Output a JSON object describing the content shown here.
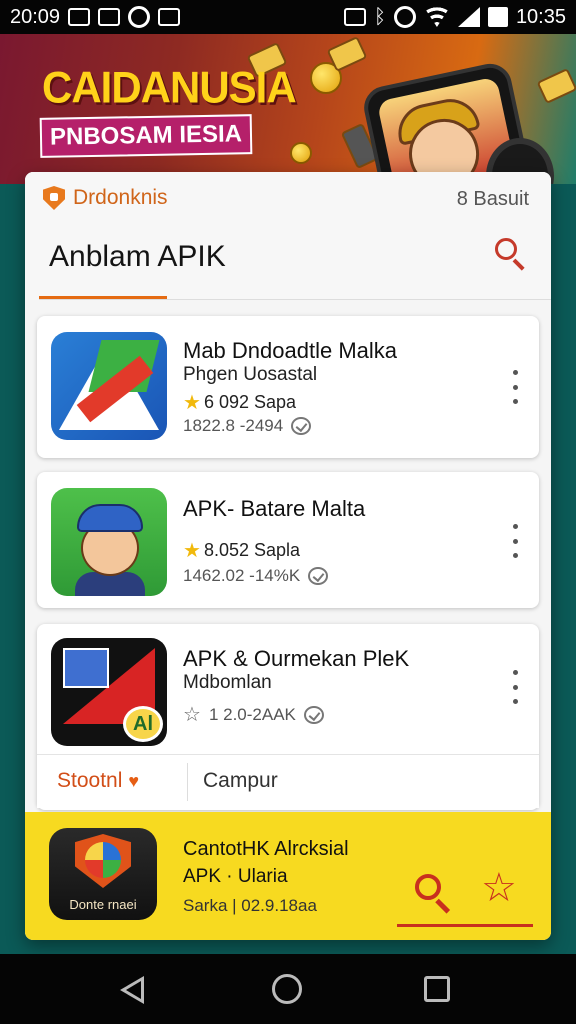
{
  "status_bar": {
    "time_left": "20:09",
    "time_right": "10:35"
  },
  "banner": {
    "title": "CAIDANUSIA",
    "subtitle": "PNBOSAM IESIA"
  },
  "header": {
    "brand": "Drdonknis",
    "right_label": "8 Basuit",
    "title": "Anblam APIK"
  },
  "apps": [
    {
      "name": "Mab Dndoadtle Malka",
      "subtitle": "Phgen Uosastal",
      "rating": "6 092 Sapa",
      "meta": "1822.8 -2494",
      "star_filled": true
    },
    {
      "name": "APK- Batare Malta",
      "subtitle": "",
      "rating": "8.052 Sapla",
      "meta": "1462.02 -14%K",
      "star_filled": true
    },
    {
      "name": "APK & Ourmekan PleK",
      "subtitle": "Mdbomlan",
      "rating": "1 2.0-2AAK",
      "meta": "",
      "star_filled": false
    }
  ],
  "apps_icon3_badge": "Al",
  "filters": {
    "left": "Stootnl",
    "right": "Campur"
  },
  "featured": {
    "icon_text": "Donte rnaei",
    "title": "CantotHK Alrcksial",
    "subtitle": "APK · Ularia",
    "meta": "Sarka | 02.9.18aa"
  },
  "colors": {
    "accent": "#e56b12",
    "featured_bg": "#f7da20",
    "page_bg": "#0b5a57",
    "icon_red": "#c8301e"
  },
  "icons": [
    "shield-icon",
    "search-icon",
    "star-icon",
    "more-icon",
    "heart-icon",
    "favorite-star-icon"
  ]
}
